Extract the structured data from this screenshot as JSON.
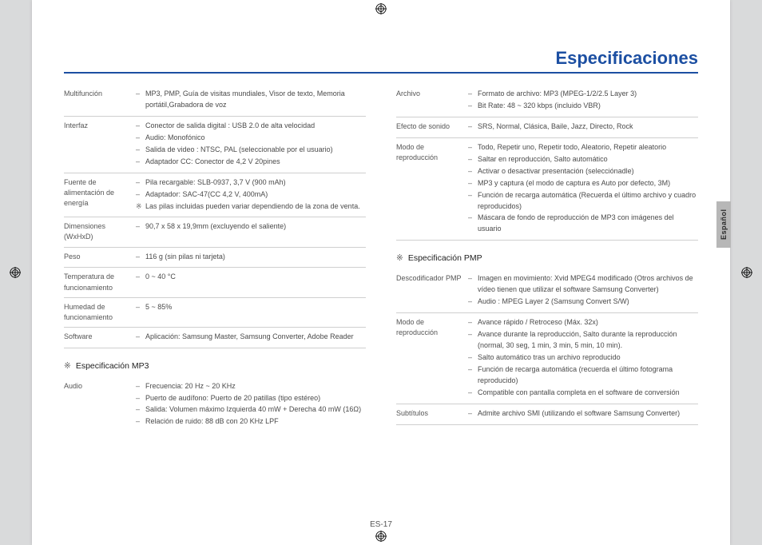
{
  "header": {
    "title": "Especificaciones"
  },
  "sideTab": "Español",
  "footer": "ES-17",
  "left": {
    "rows": [
      {
        "label": "Multifunción",
        "lines": [
          {
            "m": "-",
            "t": "MP3, PMP, Guía de visitas mundiales, Visor de texto, Memoria portátil,Grabadora de voz"
          }
        ]
      },
      {
        "label": "Interfaz",
        "lines": [
          {
            "m": "-",
            "t": "Conector de salida digital : USB 2.0 de alta velocidad"
          },
          {
            "m": "-",
            "t": "Audio: Monofónico"
          },
          {
            "m": "-",
            "t": "Salida de video : NTSC, PAL (seleccionable por el usuario)"
          },
          {
            "m": "-",
            "t": "Adaptador CC: Conector de 4,2 V 20pines"
          }
        ]
      },
      {
        "label": "Fuente de alimentación de energía",
        "lines": [
          {
            "m": "-",
            "t": "Pila recargable: SLB-0937, 3,7 V (900 mAh)"
          },
          {
            "m": "-",
            "t": "Adaptador: SAC-47(CC 4,2 V, 400mA)"
          },
          {
            "m": "*",
            "t": "Las pilas incluidas pueden variar dependiendo de la zona de venta."
          }
        ]
      },
      {
        "label": "Dimensiones (WxHxD)",
        "lines": [
          {
            "m": "-",
            "t": "90,7 x 58 x 19,9mm (excluyendo el saliente)"
          }
        ]
      },
      {
        "label": "Peso",
        "lines": [
          {
            "m": "-",
            "t": "116 g (sin pilas ni tarjeta)"
          }
        ]
      },
      {
        "label": "Temperatura de funcionamiento",
        "lines": [
          {
            "m": "-",
            "t": "0 ~ 40 °C"
          }
        ]
      },
      {
        "label": "Humedad de funcionamiento",
        "lines": [
          {
            "m": "-",
            "t": "5 ~ 85%"
          }
        ]
      },
      {
        "label": "Software",
        "lines": [
          {
            "m": "-",
            "t": "Aplicación: Samsung Master, Samsung Converter, Adobe Reader"
          }
        ]
      }
    ],
    "section": {
      "title": "Especificación MP3",
      "rows": [
        {
          "label": "Audio",
          "noborder": true,
          "lines": [
            {
              "m": "-",
              "t": "Frecuencia: 20 Hz ~ 20 KHz"
            },
            {
              "m": "-",
              "t": "Puerto de audífono: Puerto de 20 patillas (tipo estéreo)"
            },
            {
              "m": "-",
              "t": "Salida: Volumen máximo Izquierda 40 mW + Derecha 40 mW (16Ω)"
            },
            {
              "m": "-",
              "t": "Relación de ruido: 88 dB con 20 KHz LPF"
            }
          ]
        }
      ]
    }
  },
  "right": {
    "rows": [
      {
        "label": "Archivo",
        "lines": [
          {
            "m": "-",
            "t": "Formato de archivo: MP3 (MPEG-1/2/2.5 Layer 3)"
          },
          {
            "m": "-",
            "t": "Bit Rate: 48 ~ 320 kbps (incluido VBR)"
          }
        ]
      },
      {
        "label": "Efecto de sonido",
        "lines": [
          {
            "m": "-",
            "t": "SRS, Normal, Clásica, Baile, Jazz, Directo, Rock"
          }
        ]
      },
      {
        "label": "Modo de reproducción",
        "lines": [
          {
            "m": "-",
            "t": "Todo, Repetir uno, Repetir todo, Aleatorio, Repetir aleatorio"
          },
          {
            "m": "-",
            "t": "Saltar en reproducción, Salto automático"
          },
          {
            "m": "-",
            "t": "Activar o desactivar presentación (selecciónadle)"
          },
          {
            "m": "-",
            "t": "MP3 y captura (el modo de captura es Auto por defecto, 3M)"
          },
          {
            "m": "-",
            "t": "Función de recarga automática (Recuerda el último archivo y cuadro reproducidos)"
          },
          {
            "m": "-",
            "t": "Máscara de fondo de reproducción de MP3 con imágenes del usuario"
          }
        ]
      }
    ],
    "section": {
      "title": "Especificación PMP",
      "rows": [
        {
          "label": "Descodificador PMP",
          "lines": [
            {
              "m": "-",
              "t": "Imagen en movimiento: Xvid MPEG4 modificado (Otros archivos de vídeo tienen que utilizar el software Samsung Converter)"
            },
            {
              "m": "-",
              "t": "Audio : MPEG Layer 2 (Samsung Convert S/W)"
            }
          ]
        },
        {
          "label": "Modo de reproducción",
          "lines": [
            {
              "m": "-",
              "t": "Avance rápido / Retroceso (Máx. 32x)"
            },
            {
              "m": "-",
              "t": "Avance durante la reproducción, Salto durante la reproducción (normal, 30 seg, 1 min, 3 min, 5 min, 10 min)."
            },
            {
              "m": "-",
              "t": "Salto automático tras un archivo reproducido"
            },
            {
              "m": "-",
              "t": "Función de recarga automática (recuerda el último fotograma reproducido)"
            },
            {
              "m": "-",
              "t": "Compatible con pantalla completa en el software de conversión"
            }
          ]
        },
        {
          "label": "Subtítulos",
          "lines": [
            {
              "m": "-",
              "t": "Admite archivo SMI (utilizando el software Samsung Converter)"
            }
          ]
        }
      ]
    }
  }
}
